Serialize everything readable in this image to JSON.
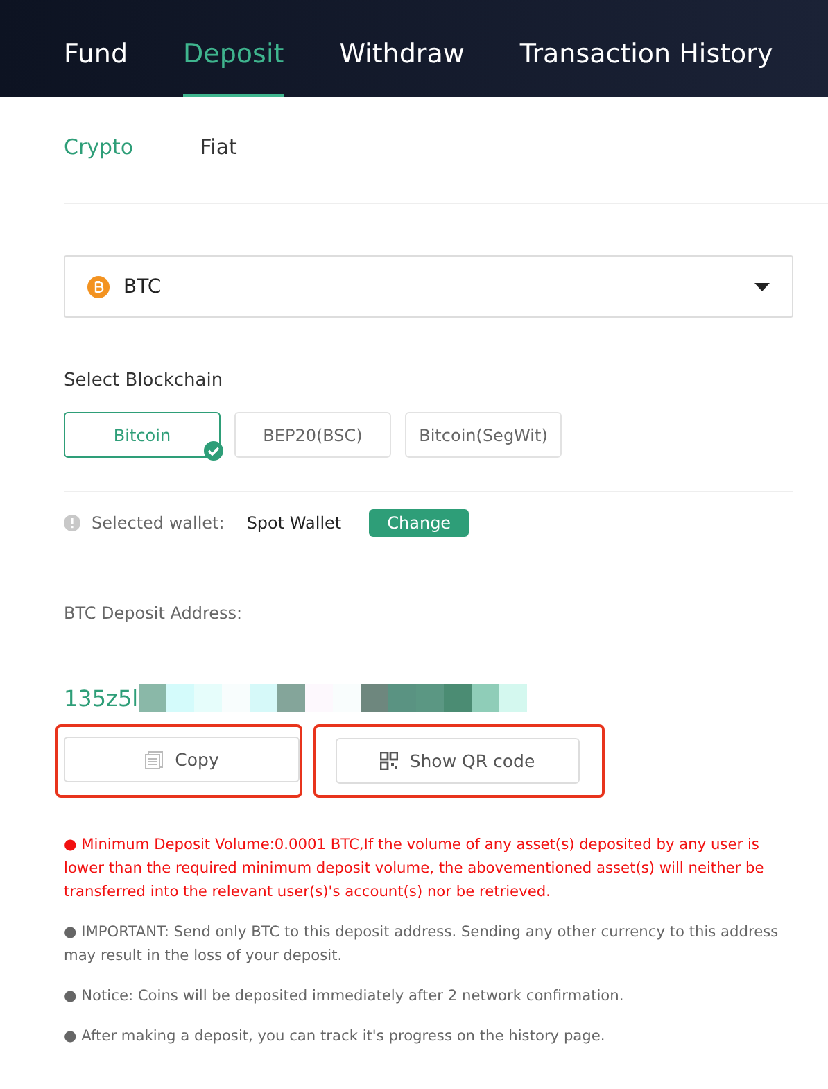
{
  "nav_tabs": [
    {
      "label": "Fund",
      "selected": false
    },
    {
      "label": "Deposit",
      "selected": true
    },
    {
      "label": "Withdraw",
      "selected": false
    },
    {
      "label": "Transaction History",
      "selected": false
    }
  ],
  "sub_tabs": [
    {
      "label": "Crypto",
      "selected": true
    },
    {
      "label": "Fiat",
      "selected": false
    }
  ],
  "coin_select": {
    "value": "BTC"
  },
  "blockchain": {
    "label": "Select Blockchain",
    "options": [
      {
        "label": "Bitcoin",
        "selected": true
      },
      {
        "label": "BEP20(BSC)",
        "selected": false
      },
      {
        "label": "Bitcoin(SegWit)",
        "selected": false
      }
    ]
  },
  "wallet": {
    "label": "Selected wallet:",
    "value": "Spot Wallet",
    "button": "Change"
  },
  "address": {
    "label": "BTC Deposit Address:",
    "value": "135z5l",
    "redacted": true
  },
  "actions": [
    {
      "kind": "copy",
      "label": "Copy",
      "highlighted": true
    },
    {
      "kind": "qr",
      "label": "Show QR code",
      "highlighted": true
    }
  ],
  "notes": [
    {
      "kind": "warning",
      "text": "● Minimum Deposit Volume:0.0001 BTC,If the volume of any asset(s) deposited by any user is lower than the required minimum deposit volume, the abovementioned asset(s) will neither be transferred into the relevant user(s)'s account(s) nor be retrieved."
    },
    {
      "kind": "info",
      "text": "● IMPORTANT: Send only BTC to this deposit address. Sending any other currency to this address may result in the loss of your deposit."
    },
    {
      "kind": "info",
      "text": "● Notice: Coins will be deposited immediately after 2 network confirmation."
    },
    {
      "kind": "info",
      "text": "● After making a deposit, you can track it's progress on the history page."
    }
  ]
}
